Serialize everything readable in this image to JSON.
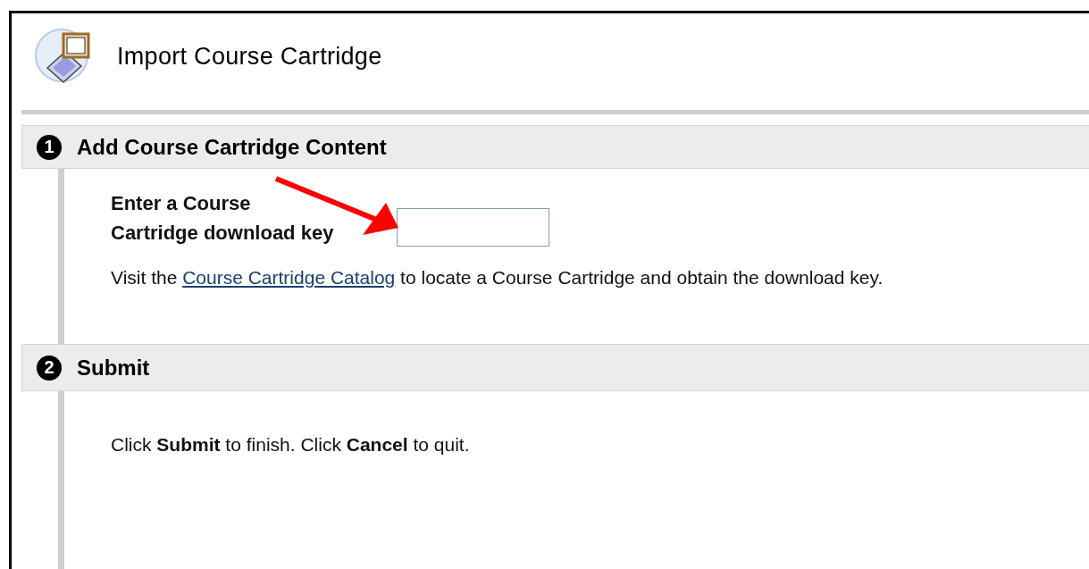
{
  "page": {
    "title": "Import Course Cartridge"
  },
  "steps": [
    {
      "number": "1",
      "title": "Add Course Cartridge Content",
      "kind": "key",
      "field_label": "Enter a Course Cartridge download key",
      "hint": {
        "before": "Visit the ",
        "link": "Course Cartridge Catalog",
        "after": " to locate a Course Cartridge and obtain the download key."
      }
    },
    {
      "number": "2",
      "title": "Submit",
      "kind": "submit",
      "instructions": "Click **Submit** to finish. Click **Cancel** to quit."
    }
  ]
}
